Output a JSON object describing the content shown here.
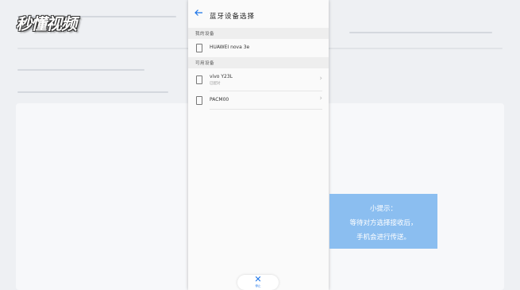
{
  "watermark": {
    "text": "秒懂视频"
  },
  "screen": {
    "title": "蓝牙设备选择",
    "my_devices_header": "我的设备",
    "available_header": "可用设备",
    "my_devices": [
      {
        "name": "HUAWEI nova 3e"
      }
    ],
    "available_devices": [
      {
        "name": "vivo Y23L",
        "status": "已配对"
      },
      {
        "name": "PACM00",
        "status": ""
      }
    ],
    "stop_label": "停止"
  },
  "tip": {
    "line1": "小提示：",
    "line2": "等待对方选择接收后，",
    "line3": "手机会进行传送。"
  },
  "colors": {
    "accent": "#1a73e8",
    "tip_bg": "#8bbef0"
  },
  "icons": {
    "back": "arrow-left-icon",
    "device": "phone-icon",
    "chevron": "chevron-right-icon",
    "stop": "close-icon"
  }
}
